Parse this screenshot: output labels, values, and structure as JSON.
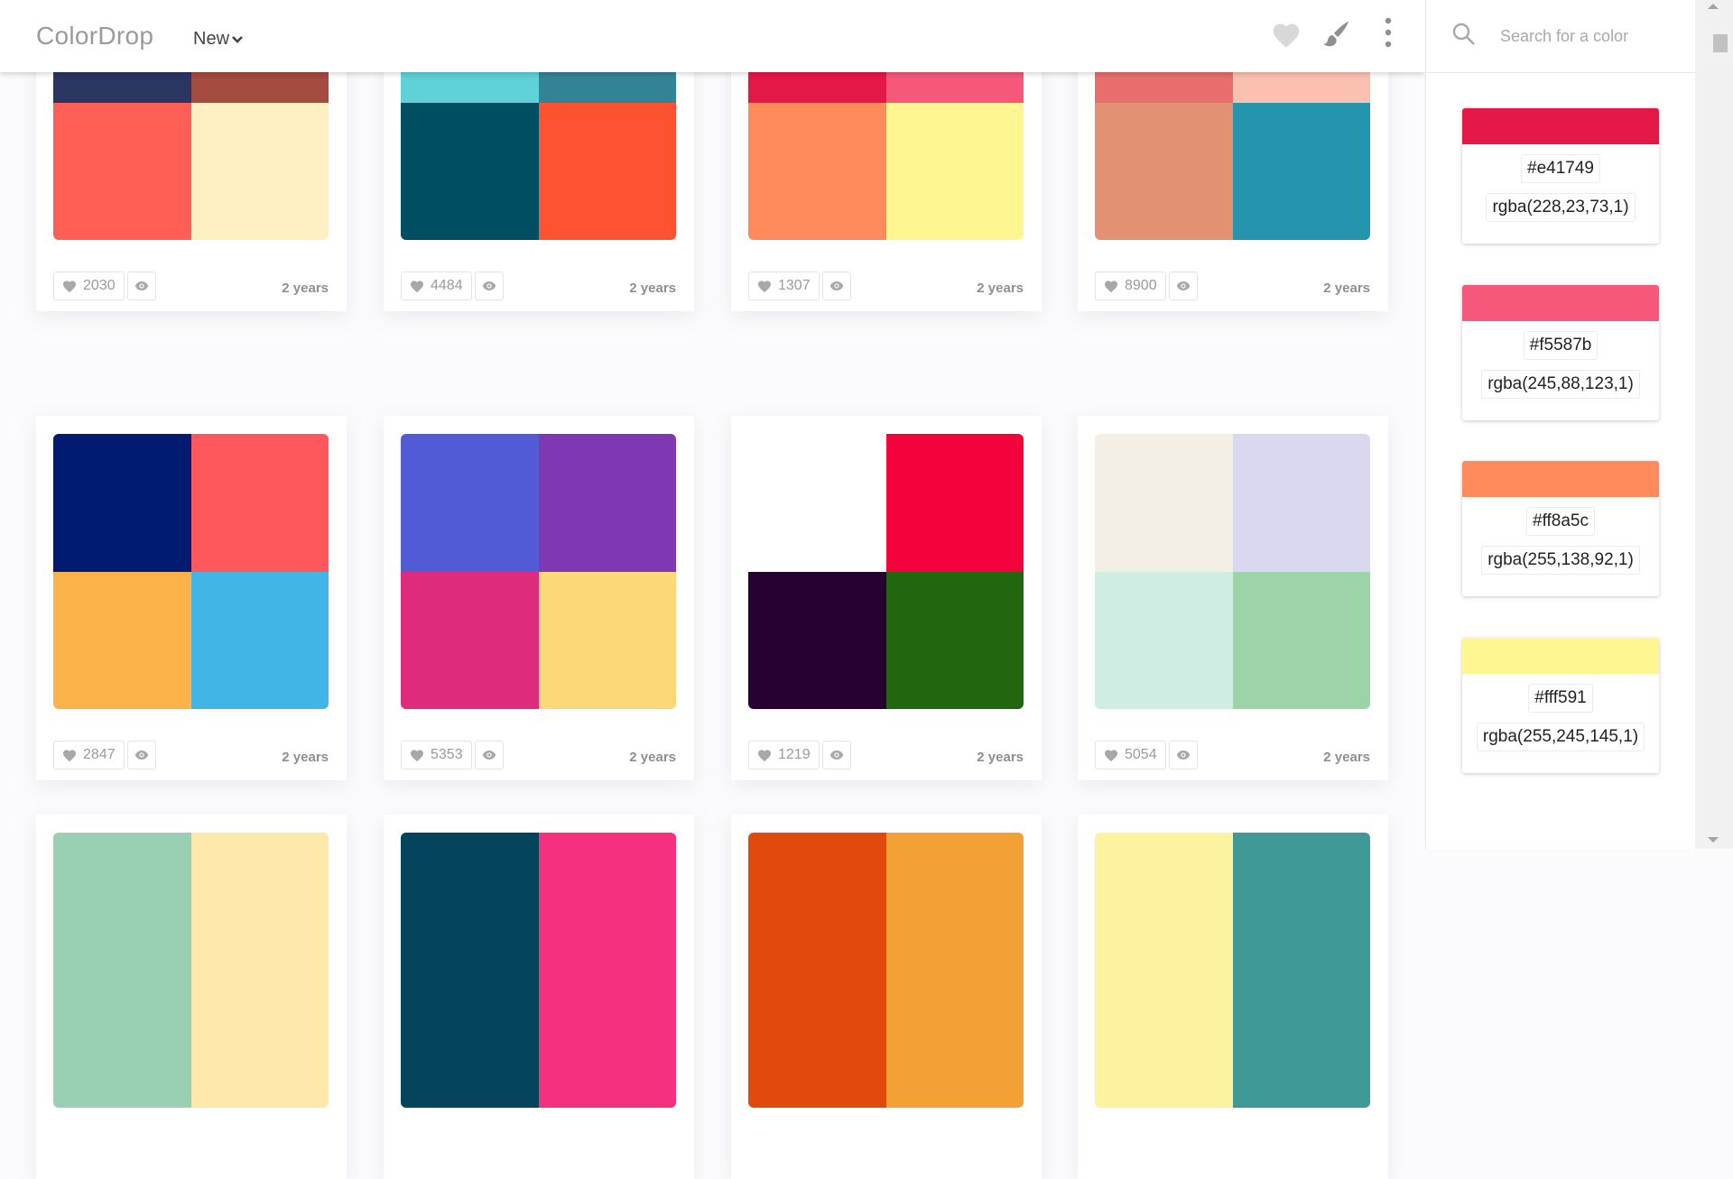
{
  "app": {
    "logo": "ColorDrop"
  },
  "nav": {
    "filter_label": "New"
  },
  "header_icons": [
    "heart-icon",
    "brush-icon",
    "more-vertical-icon"
  ],
  "search": {
    "placeholder": "Search for a color"
  },
  "selected_palette": [
    {
      "hex": "#e41749",
      "rgba": "rgba(228,23,73,1)"
    },
    {
      "hex": "#f5587b",
      "rgba": "rgba(245,88,123,1)"
    },
    {
      "hex": "#ff8a5c",
      "rgba": "rgba(255,138,92,1)"
    },
    {
      "hex": "#fff591",
      "rgba": "rgba(255,245,145,1)"
    }
  ],
  "palettes": [
    {
      "colors": [
        "#2b3562",
        "#a44a41",
        "#ff5f57",
        "#fff0c3"
      ],
      "likes": "2030",
      "time": "2 years"
    },
    {
      "colors": [
        "#5ed1d9",
        "#338397",
        "#004e62",
        "#ff5230"
      ],
      "likes": "4484",
      "time": "2 years"
    },
    {
      "colors": [
        "#e41749",
        "#f5587b",
        "#ff8a5c",
        "#fff591"
      ],
      "likes": "1307",
      "time": "2 years"
    },
    {
      "colors": [
        "#e96d6d",
        "#fcc0b0",
        "#e29272",
        "#2594ad"
      ],
      "likes": "8900",
      "time": "2 years"
    },
    {
      "colors": [
        "#011a72",
        "#ff585c",
        "#feb34a",
        "#40b5e6"
      ],
      "likes": "2847",
      "time": "2 years"
    },
    {
      "colors": [
        "#525bd6",
        "#8037b2",
        "#df2b7c",
        "#fdd878"
      ],
      "likes": "5353",
      "time": "2 years"
    },
    {
      "colors": [
        "#ffffff",
        "#f4023b",
        "#280133",
        "#21670f"
      ],
      "likes": "1219",
      "time": "2 years"
    },
    {
      "colors": [
        "#f4efe5",
        "#d9d8f1",
        "#cfede3",
        "#9cd3a7"
      ],
      "likes": "5054",
      "time": "2 years"
    },
    {
      "colors": [
        "#99cfb2",
        "#fee8aa",
        "#99cfb2",
        "#fee8aa"
      ],
      "likes": "",
      "time": ""
    },
    {
      "colors": [
        "#05445d",
        "#f5307e",
        "#05445d",
        "#f5307e"
      ],
      "likes": "",
      "time": ""
    },
    {
      "colors": [
        "#e14a0b",
        "#f3a135",
        "#e14a0b",
        "#f3a135"
      ],
      "likes": "",
      "time": ""
    },
    {
      "colors": [
        "#fdf2a0",
        "#3f9997",
        "#fdf2a0",
        "#3f9997"
      ],
      "likes": "",
      "time": ""
    }
  ]
}
